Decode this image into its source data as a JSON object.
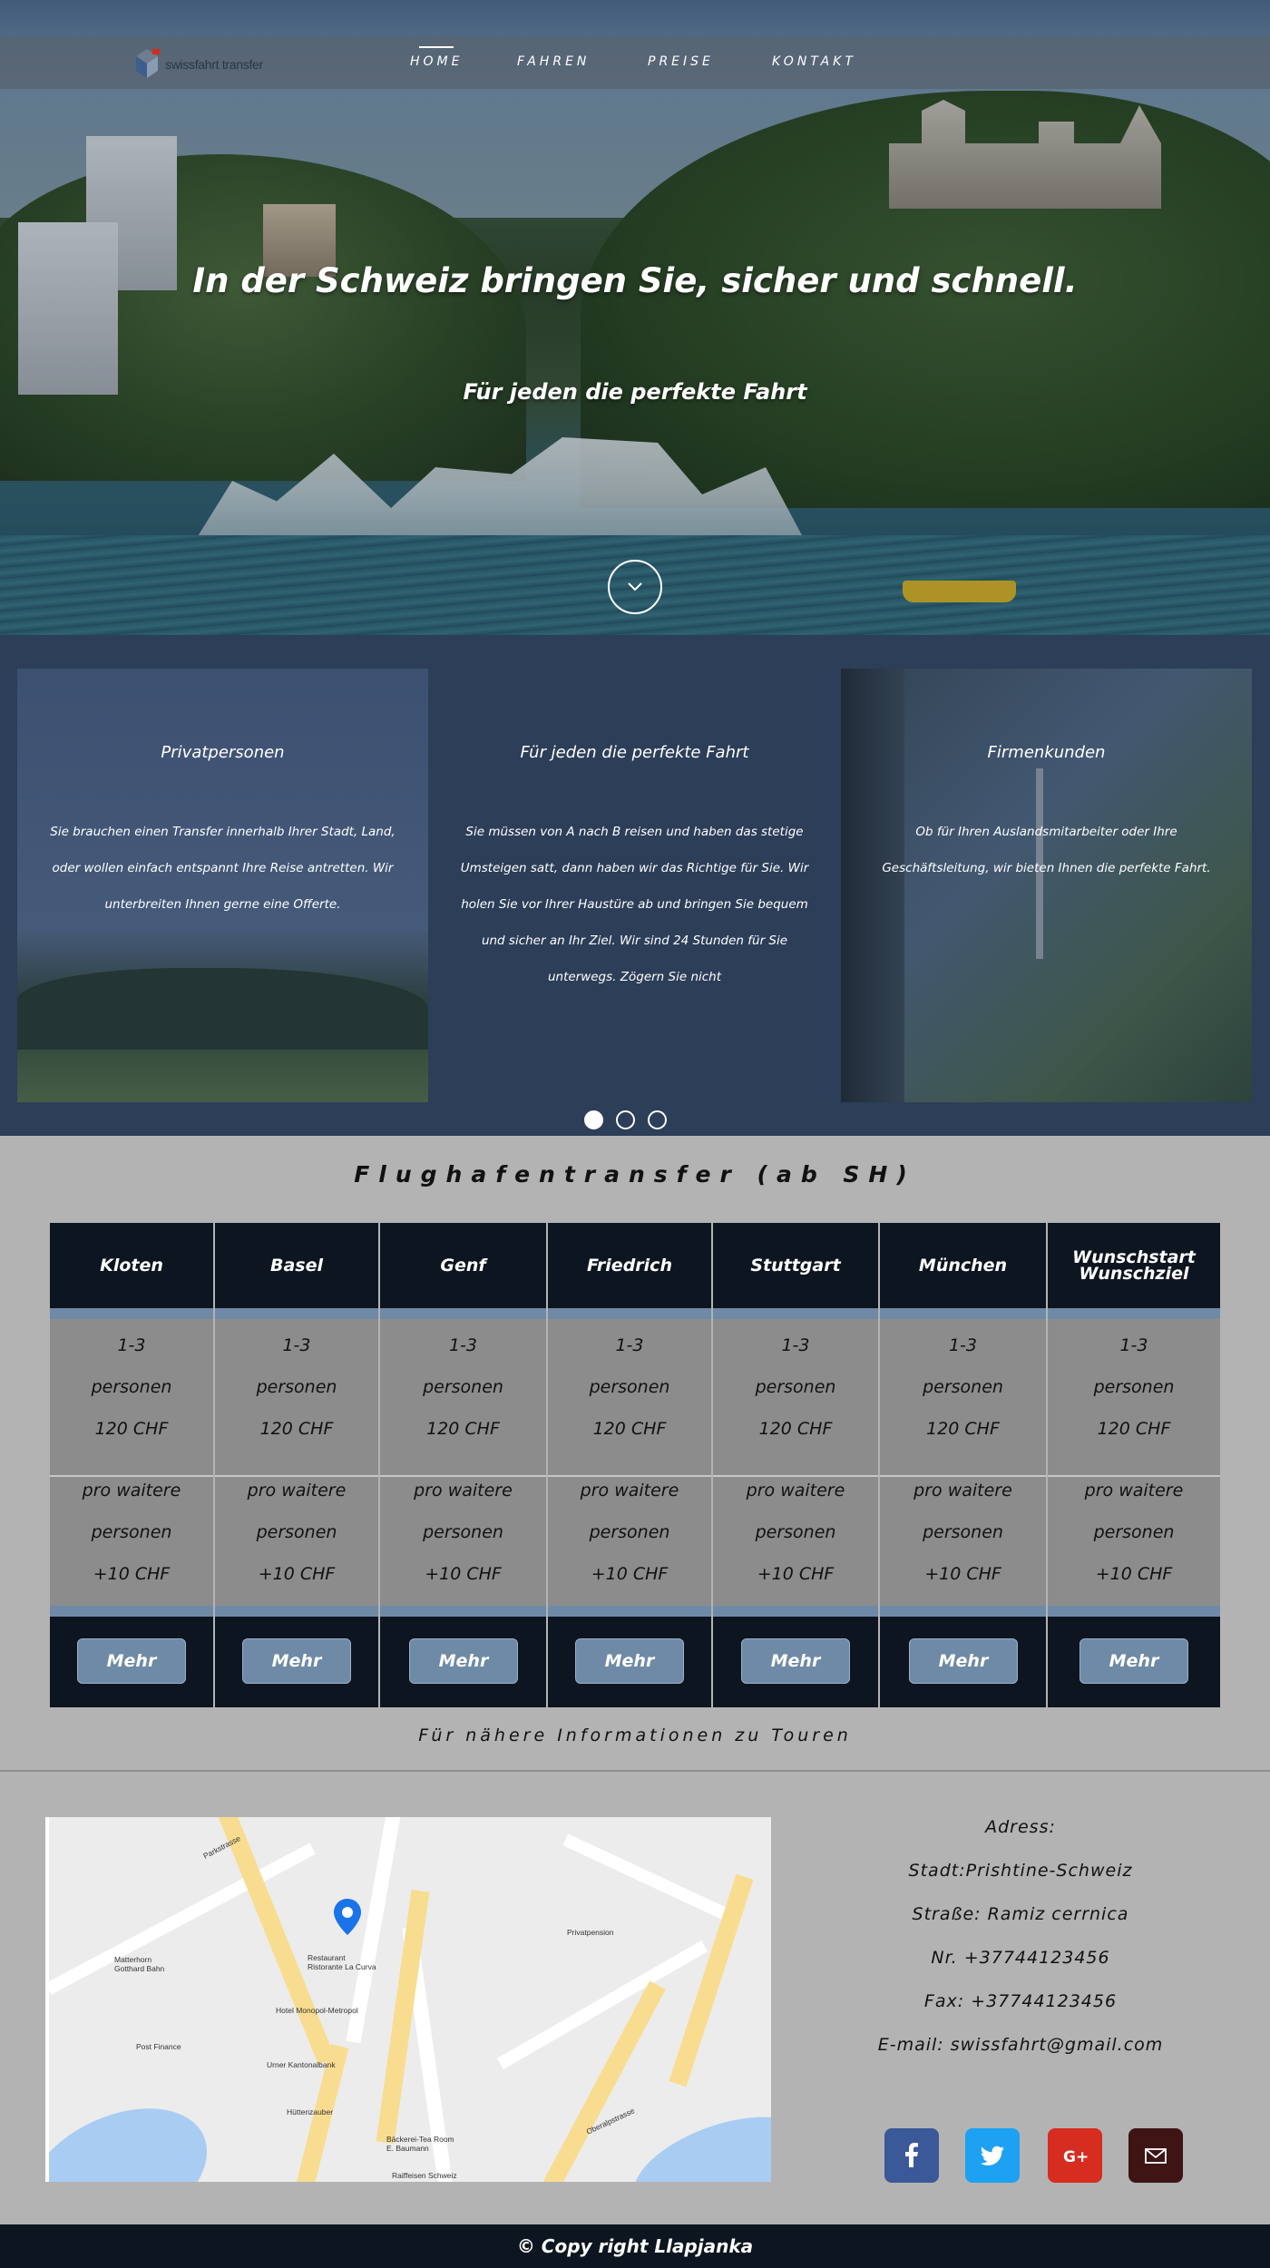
{
  "brand": {
    "name": "swissfahrt transfer"
  },
  "nav": {
    "items": [
      {
        "label": "HOME",
        "active": true
      },
      {
        "label": "FAHREN",
        "active": false
      },
      {
        "label": "PREISE",
        "active": false
      },
      {
        "label": "KONTAKT",
        "active": false
      }
    ]
  },
  "hero": {
    "title": "In der Schweiz bringen Sie, sicher und schnell.",
    "subtitle": "Für jeden die perfekte Fahrt"
  },
  "slider": {
    "cards": [
      {
        "title": "Privatpersonen",
        "text": "Sie brauchen einen Transfer innerhalb Ihrer Stadt, Land, oder wollen einfach entspannt Ihre Reise antretten. Wir unterbreiten Ihnen gerne eine Offerte."
      },
      {
        "title": "Für jeden die perfekte Fahrt",
        "text": "Sie müssen von A nach B reisen und haben das stetige Umsteigen satt, dann haben wir das Richtige für Sie. Wir holen Sie vor Ihrer Haustüre ab und bringen Sie bequem und sicher an Ihr Ziel. Wir sind 24 Stunden für Sie unterwegs. Zögern Sie nicht"
      },
      {
        "title": "Firmenkunden",
        "text": "Ob für Ihren Auslandsmitarbeiter oder Ihre Geschäftsleitung, wir bieten Ihnen die perfekte Fahrt."
      }
    ],
    "active_dot": 0,
    "dot_count": 3
  },
  "pricing": {
    "title": "Flughafentransfer (ab SH)",
    "columns": [
      {
        "head": "Kloten",
        "persons": "1-3",
        "unit": "personen",
        "price": "120  CHF",
        "extra_label": "pro waitere",
        "extra_unit": "personen",
        "extra_price": "+10 CHF",
        "button": "Mehr"
      },
      {
        "head": "Basel",
        "persons": "1-3",
        "unit": "personen",
        "price": "120  CHF",
        "extra_label": "pro waitere",
        "extra_unit": "personen",
        "extra_price": "+10 CHF",
        "button": "Mehr"
      },
      {
        "head": "Genf",
        "persons": "1-3",
        "unit": "personen",
        "price": "120  CHF",
        "extra_label": "pro waitere",
        "extra_unit": "personen",
        "extra_price": "+10 CHF",
        "button": "Mehr"
      },
      {
        "head": "Friedrich",
        "persons": "1-3",
        "unit": "personen",
        "price": "120  CHF",
        "extra_label": "pro waitere",
        "extra_unit": "personen",
        "extra_price": "+10 CHF",
        "button": "Mehr"
      },
      {
        "head": "Stuttgart",
        "persons": "1-3",
        "unit": "personen",
        "price": "120  CHF",
        "extra_label": "pro waitere",
        "extra_unit": "personen",
        "extra_price": "+10 CHF",
        "button": "Mehr"
      },
      {
        "head": "München",
        "persons": "1-3",
        "unit": "personen",
        "price": "120  CHF",
        "extra_label": "pro waitere",
        "extra_unit": "personen",
        "extra_price": "+10 CHF",
        "button": "Mehr"
      },
      {
        "head": "Wunschstart Wunschziel",
        "persons": "1-3",
        "unit": "personen",
        "price": "120  CHF",
        "extra_label": "pro waitere",
        "extra_unit": "personen",
        "extra_price": "+10 CHF",
        "button": "Mehr"
      }
    ],
    "note": "Für nähere Informationen zu Touren"
  },
  "map": {
    "labels": {
      "parkstrasse": "Parkstrasse",
      "matterhorn": "Matterhorn Gotthard Bahn",
      "restaurant": "Restaurant Ristorante La Curva",
      "monopol": "Hotel Monopol-Metropol",
      "urner": "Urner Kantonalbank",
      "post": "Post Finance",
      "hutten": "Hüttenzauber",
      "privat": "Privatpension",
      "baecker": "Bäckerei-Tea Room E. Baumann",
      "raiff": "Raiffeisen Schweiz",
      "ober": "Oberalpstrasse"
    }
  },
  "contact": {
    "lines": [
      "Adress:",
      "Stadt:Prishtine-Schweiz",
      "Straße: Ramiz cerrnica",
      "Nr. +37744123456",
      "Fax: +37744123456",
      "E-mail: swissfahrt@gmail.com"
    ]
  },
  "social": [
    {
      "name": "facebook-icon",
      "color": "#3b5998"
    },
    {
      "name": "twitter-icon",
      "color": "#1da1f2"
    },
    {
      "name": "google-plus-icon",
      "color": "#d62d20"
    },
    {
      "name": "mail-icon",
      "color": "#3e1414"
    }
  ],
  "footer": {
    "text": "© Copy right Llapjanka"
  }
}
